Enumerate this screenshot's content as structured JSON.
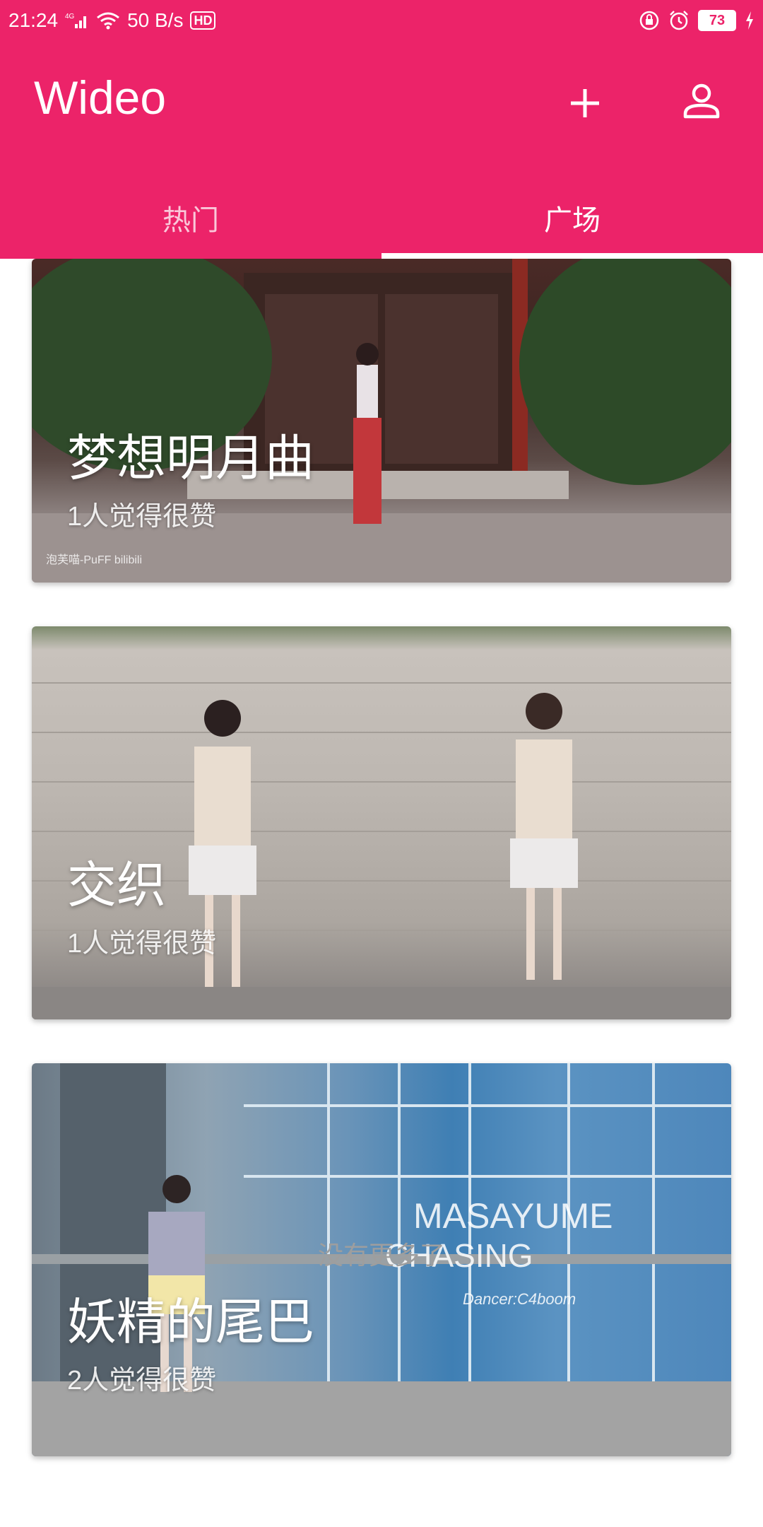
{
  "status_bar": {
    "time": "21:24",
    "network": "4G",
    "speed": "50 B/s",
    "hd": "HD",
    "battery": "73"
  },
  "toolbar": {
    "title": "Wideo",
    "add_icon": "plus-icon",
    "profile_icon": "person-icon"
  },
  "tabs": [
    {
      "label": "热门",
      "active": false
    },
    {
      "label": "广场",
      "active": true
    }
  ],
  "feed": {
    "cards": [
      {
        "title": "梦想明月曲",
        "likes": "1人觉得很赞",
        "watermark": "泡芙喵-PuFF bilibili"
      },
      {
        "title": "交织",
        "likes": "1人觉得很赞"
      },
      {
        "title": "妖精的尾巴",
        "likes": "2人觉得很赞",
        "overlay_lines": [
          "MASAYUME",
          "CHASING",
          "Dancer:C4boom"
        ]
      }
    ],
    "end_text": "没有更多了"
  },
  "colors": {
    "primary": "#ec2369",
    "footer_text": "#9e9e9e"
  }
}
